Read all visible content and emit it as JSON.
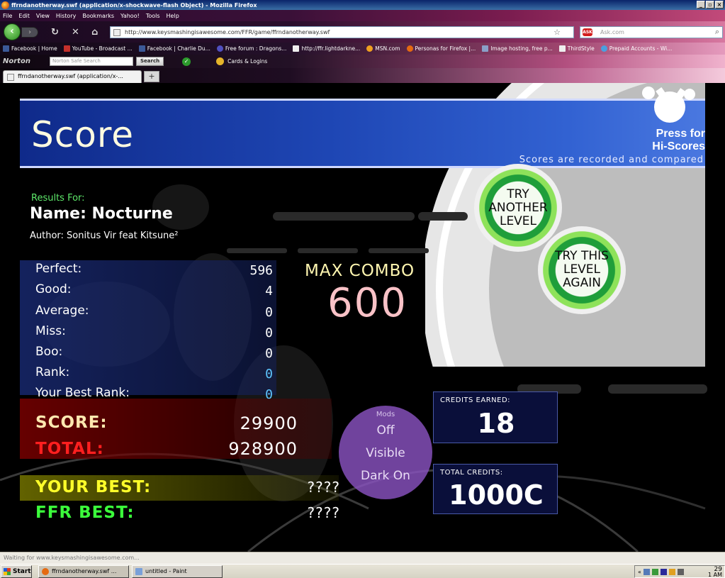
{
  "window": {
    "title": "ffrndanotherway.swf (application/x-shockwave-flash Object) - Mozilla Firefox",
    "buttons": [
      "_",
      "▫",
      "×"
    ]
  },
  "menu": [
    "File",
    "Edit",
    "View",
    "History",
    "Bookmarks",
    "Yahoo!",
    "Tools",
    "Help"
  ],
  "nav": {
    "url": "http://www.keysmashingisawesome.com/FFR/game/ffrndanotherway.swf",
    "search_placeholder": "Ask.com",
    "search_engine_icon": "ask-icon"
  },
  "bookmarks": [
    "Facebook | Home",
    "YouTube - Broadcast ...",
    "Facebook | Charlie Du...",
    "Free forum : Dragons...",
    "http://ffr.lightdarkne...",
    "MSN.com",
    "Personas for Firefox |...",
    "Image hosting, free p...",
    "ThirdStyle",
    "Prepaid Accounts - Wi..."
  ],
  "norton": {
    "logo": "Norton",
    "search_placeholder": "Norton Safe Search",
    "search_button": "Search",
    "cards": "Cards & Logins"
  },
  "tab": {
    "title": "ffrndanotherway.swf (application/x-...",
    "new_tab": "+"
  },
  "game": {
    "title": "Score",
    "press_hi": [
      "Press for",
      "Hi-Scores"
    ],
    "recorded": "Scores are recorded and compared",
    "results_for": "Results For:",
    "name": "Name: Nocturne",
    "author": "Author: Sonitus Vir feat Kitsune²",
    "stats": [
      {
        "label": "Perfect:",
        "value": "596"
      },
      {
        "label": "Good:",
        "value": "4"
      },
      {
        "label": "Average:",
        "value": "0"
      },
      {
        "label": "Miss:",
        "value": "0"
      },
      {
        "label": "Boo:",
        "value": "0"
      },
      {
        "label": "Rank:",
        "value": "0"
      },
      {
        "label": "Your Best Rank:",
        "value": "0"
      }
    ],
    "max_combo_label": "MAX COMBO",
    "max_combo_value": "600",
    "score_label": "SCORE:",
    "score_value": "29900",
    "total_label": "TOTAL:",
    "total_value": "928900",
    "your_best_label": "YOUR BEST:",
    "your_best_value": "????",
    "ffr_best_label": "FFR BEST:",
    "ffr_best_value": "????",
    "mods": {
      "title": "Mods",
      "items": [
        "Off",
        "Visible",
        "Dark On"
      ]
    },
    "credits_earned_label": "CREDITS EARNED:",
    "credits_earned_value": "18",
    "total_credits_label": "TOTAL CREDITS:",
    "total_credits_value": "1000C",
    "try_another": [
      "TRY",
      "ANOTHER",
      "LEVEL"
    ],
    "try_again": [
      "TRY THIS",
      "LEVEL",
      "AGAIN"
    ],
    "colors": {
      "score_label": "#ffe9b0",
      "total_label": "#ff1f1f",
      "your_best_label": "#ffff2a",
      "ffr_best_label": "#3bff3b",
      "header_blue": "#1e46b4"
    }
  },
  "status": "Waiting for www.keysmashingisawesome.com...",
  "taskbar": {
    "start": "Start",
    "items": [
      "ffrndanotherway.swf ...",
      "untitled - Paint"
    ],
    "clock": [
      "1",
      "29",
      "AM"
    ]
  }
}
